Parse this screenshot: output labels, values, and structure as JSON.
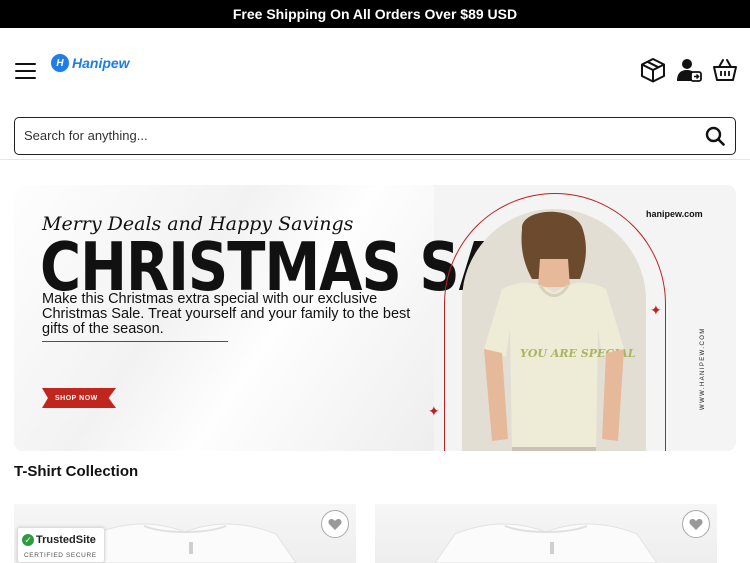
{
  "announcement": {
    "text": "Free Shipping On All Orders Over $89 USD"
  },
  "header": {
    "logo_text": "Hanipew",
    "icons": [
      "menu-icon",
      "package-icon",
      "account-icon",
      "cart-icon"
    ]
  },
  "search": {
    "placeholder": "Search for anything..."
  },
  "banner": {
    "subtitle": "Merry Deals and Happy Savings",
    "title": "CHRISTMAS SALE",
    "description": "Make this Christmas extra special with our exclusive Christmas Sale. Treat yourself and your family to the best gifts of the season.",
    "cta": "SHOP NOW",
    "url": "hanipew.com",
    "vertical_url": "WWW.HANIPEW.COM",
    "shirt_text": "YOU ARE SPECIAL"
  },
  "collection": {
    "title": "T-Shirt Collection"
  },
  "trust_badge": {
    "name": "TrustedSite",
    "sub": "CERTIFIED SECURE"
  },
  "colors": {
    "accent": "#1c7ee6",
    "sale_red": "#c0261d",
    "announce_bg": "#000000"
  }
}
